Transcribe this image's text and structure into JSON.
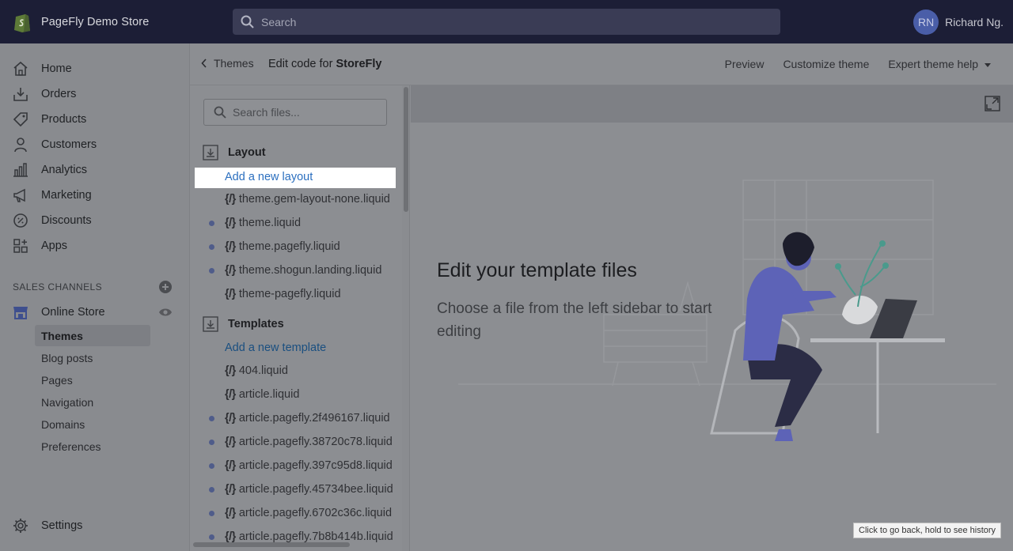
{
  "topbar": {
    "store_name": "PageFly Demo Store",
    "search_placeholder": "Search",
    "avatar_initials": "RN",
    "user_name": "Richard Ng."
  },
  "nav": {
    "items": [
      {
        "label": "Home",
        "icon": "home-icon"
      },
      {
        "label": "Orders",
        "icon": "orders-icon"
      },
      {
        "label": "Products",
        "icon": "tag-icon"
      },
      {
        "label": "Customers",
        "icon": "person-icon"
      },
      {
        "label": "Analytics",
        "icon": "bar-chart-icon"
      },
      {
        "label": "Marketing",
        "icon": "megaphone-icon"
      },
      {
        "label": "Discounts",
        "icon": "discount-icon"
      },
      {
        "label": "Apps",
        "icon": "apps-icon"
      }
    ],
    "sales_channels_label": "SALES CHANNELS",
    "online_store_label": "Online Store",
    "sub_items": [
      "Themes",
      "Blog posts",
      "Pages",
      "Navigation",
      "Domains",
      "Preferences"
    ],
    "settings_label": "Settings"
  },
  "header": {
    "back_label": "Themes",
    "title_prefix": "Edit code for ",
    "title_theme": "StoreFly",
    "preview": "Preview",
    "customize": "Customize theme",
    "expert_help": "Expert theme help"
  },
  "files": {
    "search_placeholder": "Search files...",
    "layout_folder": "Layout",
    "add_layout": "Add a new layout",
    "brace": "{/}",
    "layout_files": [
      "theme.gem-layout-none.liquid",
      "theme.liquid",
      "theme.pagefly.liquid",
      "theme.shogun.landing.liquid",
      "theme-pagefly.liquid"
    ],
    "templates_folder": "Templates",
    "add_template": "Add a new template",
    "template_files": [
      "404.liquid",
      "article.liquid",
      "article.pagefly.2f496167.liquid",
      "article.pagefly.38720c78.liquid",
      "article.pagefly.397c95d8.liquid",
      "article.pagefly.45734bee.liquid",
      "article.pagefly.6702c36c.liquid",
      "article.pagefly.7b8b414b.liquid"
    ]
  },
  "main": {
    "empty_title": "Edit your template files",
    "empty_desc": "Choose a file from the left sidebar to start editing"
  },
  "tooltip": "Click to go back, hold to see history",
  "colors": {
    "topbar": "#1c1e36",
    "overlay": "#8c8e92",
    "link": "#2b6fbf",
    "highlight": "#ffffff"
  }
}
